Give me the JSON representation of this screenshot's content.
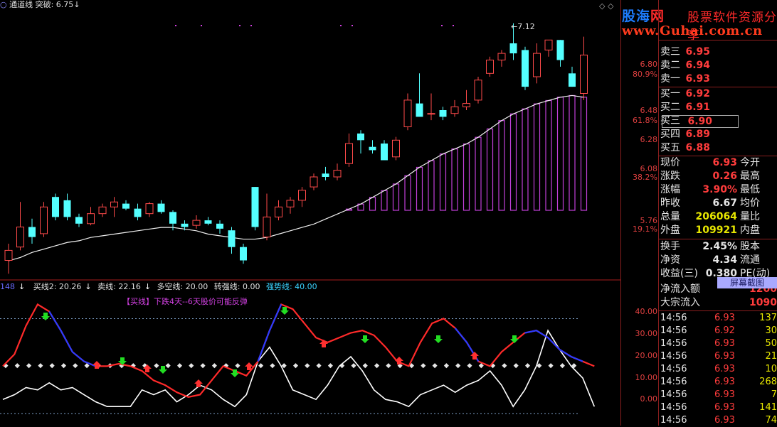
{
  "header": {
    "indicator_name": "通道线",
    "breakout_label": "突破: 6.75",
    "arrow": "↓"
  },
  "logo": {
    "cn_prefix": "股海",
    "cn_suffix": "网",
    "tagline": "股票软件资源分享",
    "url": "www.Guhai.com.cn"
  },
  "price_axis": {
    "labels": [
      {
        "text": "6.80",
        "pct": "80.9%"
      },
      {
        "text": "6.48",
        "pct": "61.8%"
      },
      {
        "text": "6.28",
        "pct": ""
      },
      {
        "text": "6.08",
        "pct": "38.2%"
      },
      {
        "text": "5.76",
        "pct": "19.1%"
      }
    ],
    "high_marker": "7.12"
  },
  "quote": {
    "sell": [
      {
        "label": "卖三",
        "price": "6.95"
      },
      {
        "label": "卖二",
        "price": "6.94"
      },
      {
        "label": "卖一",
        "price": "6.93"
      }
    ],
    "buy": [
      {
        "label": "买一",
        "price": "6.92"
      },
      {
        "label": "买二",
        "price": "6.91"
      },
      {
        "label": "买三",
        "price": "6.90"
      },
      {
        "label": "买四",
        "price": "6.89"
      },
      {
        "label": "买五",
        "price": "6.88"
      }
    ],
    "stats": [
      {
        "label": "现价",
        "value": "6.93",
        "label2": "今开"
      },
      {
        "label": "涨跌",
        "value": "0.26",
        "label2": "最高"
      },
      {
        "label": "涨幅",
        "value": "3.90%",
        "label2": "最低"
      },
      {
        "label": "昨收",
        "value": "6.67",
        "label2": "均价"
      },
      {
        "label": "总量",
        "value": "206064",
        "label2": "量比"
      },
      {
        "label": "外盘",
        "value": "109921",
        "label2": "内盘"
      },
      {
        "label": "换手",
        "value": "2.45%",
        "label2": "股本"
      },
      {
        "label": "净资",
        "value": "4.34",
        "label2": "流通"
      },
      {
        "label": "收益(三)",
        "value": "0.380",
        "label2": "PE(动)"
      }
    ],
    "flow": [
      {
        "label": "净流入额",
        "value": "1200"
      },
      {
        "label": "大宗流入",
        "value": "1090"
      }
    ],
    "screenshot_button": "屏幕截图"
  },
  "ticks": [
    {
      "time": "14:56",
      "price": "6.93",
      "vol": "137"
    },
    {
      "time": "14:56",
      "price": "6.92",
      "vol": "30"
    },
    {
      "time": "14:56",
      "price": "6.93",
      "vol": "50"
    },
    {
      "time": "14:56",
      "price": "6.93",
      "vol": "21"
    },
    {
      "time": "14:56",
      "price": "6.93",
      "vol": "10"
    },
    {
      "time": "14:56",
      "price": "6.93",
      "vol": "268"
    },
    {
      "time": "14:56",
      "price": "6.93",
      "vol": "7"
    },
    {
      "time": "14:56",
      "price": "6.93",
      "vol": "141"
    },
    {
      "time": "14:56",
      "price": "6.93",
      "vol": "74"
    }
  ],
  "indicator": {
    "code": "148",
    "buy2": "买线2: 20.26",
    "sell_line": "卖线: 22.16",
    "multi": "多空线: 20.00",
    "strong_turn": "转强线: 0.00",
    "strong": "强势线: 40.00",
    "note": "【买线】下跌4天--6天股价可能反弹",
    "y_labels": [
      "40.00",
      "30.00",
      "20.00",
      "10.00",
      "0.00"
    ]
  },
  "chart_data": {
    "type": "candlestick",
    "price_range": [
      5.6,
      7.2
    ],
    "candles": [
      {
        "o": 5.7,
        "c": 5.76,
        "h": 5.8,
        "l": 5.62
      },
      {
        "o": 5.78,
        "c": 5.9,
        "h": 6.05,
        "l": 5.76
      },
      {
        "o": 5.9,
        "c": 5.84,
        "h": 5.95,
        "l": 5.8
      },
      {
        "o": 5.86,
        "c": 6.02,
        "h": 6.05,
        "l": 5.84
      },
      {
        "o": 6.08,
        "c": 5.96,
        "h": 6.1,
        "l": 5.94
      },
      {
        "o": 6.06,
        "c": 5.96,
        "h": 6.1,
        "l": 5.94
      },
      {
        "o": 5.96,
        "c": 5.92,
        "h": 5.98,
        "l": 5.9
      },
      {
        "o": 5.92,
        "c": 5.98,
        "h": 6.02,
        "l": 5.91
      },
      {
        "o": 5.98,
        "c": 6.02,
        "h": 6.04,
        "l": 5.96
      },
      {
        "o": 6.02,
        "c": 6.05,
        "h": 6.08,
        "l": 5.96
      },
      {
        "o": 6.04,
        "c": 6.01,
        "h": 6.06,
        "l": 6.0
      },
      {
        "o": 6.01,
        "c": 5.96,
        "h": 6.04,
        "l": 5.94
      },
      {
        "o": 5.98,
        "c": 6.04,
        "h": 6.05,
        "l": 5.96
      },
      {
        "o": 6.04,
        "c": 5.99,
        "h": 6.06,
        "l": 5.98
      },
      {
        "o": 5.99,
        "c": 5.92,
        "h": 6.0,
        "l": 5.88
      },
      {
        "o": 5.92,
        "c": 5.9,
        "h": 5.94,
        "l": 5.88
      },
      {
        "o": 5.91,
        "c": 5.94,
        "h": 5.97,
        "l": 5.89
      },
      {
        "o": 5.94,
        "c": 5.92,
        "h": 5.96,
        "l": 5.91
      },
      {
        "o": 5.92,
        "c": 5.89,
        "h": 5.94,
        "l": 5.86
      },
      {
        "o": 5.88,
        "c": 5.78,
        "h": 5.9,
        "l": 5.74
      },
      {
        "o": 5.78,
        "c": 5.7,
        "h": 5.8,
        "l": 5.68
      },
      {
        "o": 6.14,
        "c": 5.9,
        "h": 6.14,
        "l": 5.88
      },
      {
        "o": 5.84,
        "c": 5.96,
        "h": 6.1,
        "l": 5.82
      },
      {
        "o": 5.96,
        "c": 6.02,
        "h": 6.06,
        "l": 5.94
      },
      {
        "o": 6.02,
        "c": 6.06,
        "h": 6.08,
        "l": 5.98
      },
      {
        "o": 6.06,
        "c": 6.12,
        "h": 6.14,
        "l": 6.02
      },
      {
        "o": 6.14,
        "c": 6.2,
        "h": 6.22,
        "l": 6.12
      },
      {
        "o": 6.22,
        "c": 6.2,
        "h": 6.26,
        "l": 6.18
      },
      {
        "o": 6.2,
        "c": 6.24,
        "h": 6.28,
        "l": 6.18
      },
      {
        "o": 6.28,
        "c": 6.4,
        "h": 6.46,
        "l": 6.26
      },
      {
        "o": 6.46,
        "c": 6.42,
        "h": 6.48,
        "l": 6.34
      },
      {
        "o": 6.38,
        "c": 6.36,
        "h": 6.42,
        "l": 6.34
      },
      {
        "o": 6.4,
        "c": 6.3,
        "h": 6.42,
        "l": 6.3
      },
      {
        "o": 6.32,
        "c": 6.42,
        "h": 6.44,
        "l": 6.3
      },
      {
        "o": 6.5,
        "c": 6.66,
        "h": 6.7,
        "l": 6.48
      },
      {
        "o": 6.64,
        "c": 6.56,
        "h": 6.82,
        "l": 6.58
      },
      {
        "o": 6.58,
        "c": 6.58,
        "h": 6.7,
        "l": 6.54
      },
      {
        "o": 6.6,
        "c": 6.56,
        "h": 6.62,
        "l": 6.54
      },
      {
        "o": 6.58,
        "c": 6.62,
        "h": 6.66,
        "l": 6.56
      },
      {
        "o": 6.62,
        "c": 6.64,
        "h": 6.72,
        "l": 6.6
      },
      {
        "o": 6.66,
        "c": 6.78,
        "h": 6.8,
        "l": 6.64
      },
      {
        "o": 6.82,
        "c": 6.9,
        "h": 6.92,
        "l": 6.8
      },
      {
        "o": 6.9,
        "c": 6.94,
        "h": 6.96,
        "l": 6.86
      },
      {
        "o": 7.0,
        "c": 6.94,
        "h": 7.12,
        "l": 6.9
      },
      {
        "o": 6.96,
        "c": 6.74,
        "h": 6.98,
        "l": 6.72
      },
      {
        "o": 6.8,
        "c": 6.94,
        "h": 7.0,
        "l": 6.76
      },
      {
        "o": 6.96,
        "c": 7.02,
        "h": 7.02,
        "l": 6.92
      },
      {
        "o": 7.02,
        "c": 6.9,
        "h": 7.02,
        "l": 6.86
      },
      {
        "o": 6.82,
        "c": 6.74,
        "h": 6.86,
        "l": 6.74
      },
      {
        "o": 6.7,
        "c": 6.93,
        "h": 7.04,
        "l": 6.66
      }
    ],
    "channel": [
      5.74,
      5.76,
      5.79,
      5.81,
      5.83,
      5.85,
      5.86,
      5.88,
      5.89,
      5.9,
      5.91,
      5.92,
      5.93,
      5.94,
      5.94,
      5.93,
      5.92,
      5.9,
      5.89,
      5.88,
      5.87,
      5.87,
      5.88,
      5.9,
      5.92,
      5.94,
      5.96,
      5.99,
      6.02,
      6.05,
      6.08,
      6.12,
      6.16,
      6.2,
      6.25,
      6.3,
      6.34,
      6.38,
      6.41,
      6.44,
      6.48,
      6.53,
      6.58,
      6.62,
      6.65,
      6.68,
      6.7,
      6.72,
      6.73,
      6.72
    ],
    "indicator_range": [
      -5,
      50
    ],
    "white_line": [
      6,
      8,
      11,
      10,
      13,
      10,
      11,
      8,
      5,
      3,
      3,
      3,
      10,
      8,
      10,
      5,
      8,
      12,
      10,
      6,
      3,
      8,
      22,
      28,
      20,
      10,
      8,
      6,
      12,
      20,
      24,
      18,
      10,
      6,
      5,
      3,
      8,
      10,
      12,
      9,
      12,
      14,
      18,
      12,
      3,
      10,
      20,
      35,
      27,
      20,
      15,
      3
    ],
    "red_line": [
      20,
      25,
      37,
      46,
      43,
      35,
      26,
      22,
      20,
      20,
      21,
      20,
      18,
      14,
      12,
      9,
      7,
      8,
      14,
      20,
      18,
      16,
      22,
      35,
      46,
      44,
      38,
      32,
      30,
      32,
      34,
      35,
      33,
      28,
      22,
      20,
      30,
      38,
      40,
      36,
      30,
      22,
      20,
      26,
      30,
      34,
      35,
      32,
      27,
      24,
      22,
      20
    ]
  }
}
